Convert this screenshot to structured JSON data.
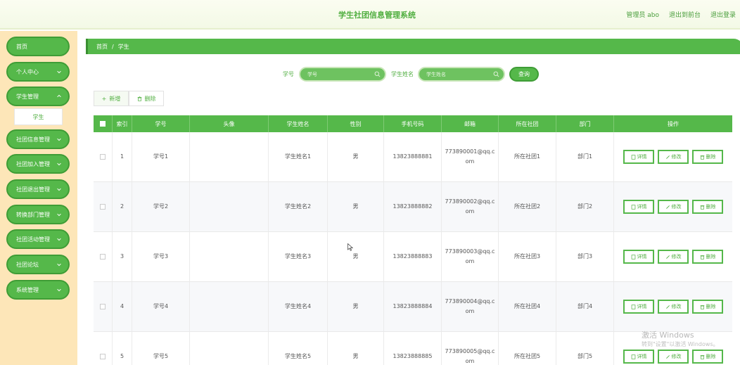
{
  "header": {
    "title": "学生社团信息管理系统",
    "user": "管理员 abo",
    "to_front": "退出到前台",
    "logout": "退出登录"
  },
  "sidebar": {
    "items": [
      {
        "label": "首页",
        "has_chevron": false
      },
      {
        "label": "个人中心",
        "has_chevron": true
      },
      {
        "label": "学生管理",
        "has_chevron": true
      },
      {
        "label": "社团信息管理",
        "has_chevron": true
      },
      {
        "label": "社团加入管理",
        "has_chevron": true
      },
      {
        "label": "社团退出管理",
        "has_chevron": true
      },
      {
        "label": "转换部门管理",
        "has_chevron": true
      },
      {
        "label": "社团活动管理",
        "has_chevron": true
      },
      {
        "label": "社团论坛",
        "has_chevron": true
      },
      {
        "label": "系统管理",
        "has_chevron": true
      }
    ],
    "active_sub": "学生"
  },
  "breadcrumb": {
    "home": "首页",
    "sep": "/",
    "current": "学生"
  },
  "search": {
    "student_no_label": "学号",
    "student_no_placeholder": "学号",
    "student_name_label": "学生姓名",
    "student_name_placeholder": "学生姓名",
    "query_label": "查询"
  },
  "actions": {
    "add_label": "新增",
    "delete_label": "删除"
  },
  "table": {
    "columns": [
      "索引",
      "学号",
      "头像",
      "学生姓名",
      "性别",
      "手机号码",
      "邮箱",
      "所在社团",
      "部门",
      "操作"
    ],
    "rows": [
      {
        "index": "1",
        "no": "学号1",
        "avatar": "",
        "name": "学生姓名1",
        "gender": "男",
        "phone": "13823888881",
        "email": "773890001@qq.com",
        "club": "所在社团1",
        "dept": "部门1"
      },
      {
        "index": "2",
        "no": "学号2",
        "avatar": "",
        "name": "学生姓名2",
        "gender": "男",
        "phone": "13823888882",
        "email": "773890002@qq.com",
        "club": "所在社团2",
        "dept": "部门2"
      },
      {
        "index": "3",
        "no": "学号3",
        "avatar": "",
        "name": "学生姓名3",
        "gender": "男",
        "phone": "13823888883",
        "email": "773890003@qq.com",
        "club": "所在社团3",
        "dept": "部门3"
      },
      {
        "index": "4",
        "no": "学号4",
        "avatar": "",
        "name": "学生姓名4",
        "gender": "男",
        "phone": "13823888884",
        "email": "773890004@qq.com",
        "club": "所在社团4",
        "dept": "部门4"
      },
      {
        "index": "5",
        "no": "学号5",
        "avatar": "",
        "name": "学生姓名5",
        "gender": "男",
        "phone": "13823888885",
        "email": "773890005@qq.com",
        "club": "所在社团5",
        "dept": "部门5"
      }
    ],
    "op_detail": "详情",
    "op_edit": "修改",
    "op_delete": "删除"
  },
  "watermark": {
    "line1": "激活 Windows",
    "line2": "转到\"设置\"以激活 Windows。"
  },
  "colors": {
    "primary": "#55b84a",
    "sidebar_bg": "#fde6b8",
    "header_bg": "#fbfdf1"
  }
}
